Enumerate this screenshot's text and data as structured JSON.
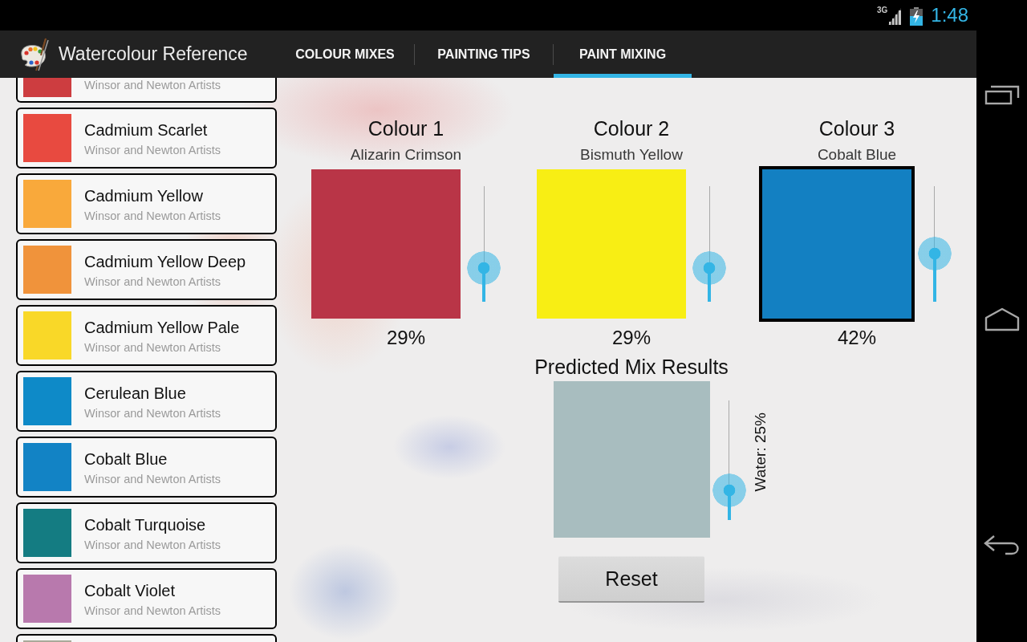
{
  "status_bar": {
    "network": "3G",
    "time": "1:48"
  },
  "app_bar": {
    "title": "Watercolour Reference",
    "tabs": [
      {
        "label": "COLOUR MIXES",
        "selected": false
      },
      {
        "label": "PAINTING TIPS",
        "selected": false
      },
      {
        "label": "PAINT MIXING",
        "selected": true
      }
    ]
  },
  "paint_list": [
    {
      "maker": "Winsor and Newton Artists",
      "color": "#cd3d40"
    },
    {
      "name": "Cadmium Scarlet",
      "maker": "Winsor and Newton Artists",
      "color": "#e84a40"
    },
    {
      "name": "Cadmium Yellow",
      "maker": "Winsor and Newton Artists",
      "color": "#f9a93b"
    },
    {
      "name": "Cadmium Yellow Deep",
      "maker": "Winsor and Newton Artists",
      "color": "#f0933b"
    },
    {
      "name": "Cadmium Yellow Pale",
      "maker": "Winsor and Newton Artists",
      "color": "#f9d828"
    },
    {
      "name": "Cerulean Blue",
      "maker": "Winsor and Newton Artists",
      "color": "#0e8ac8"
    },
    {
      "name": "Cobalt Blue",
      "maker": "Winsor and Newton Artists",
      "color": "#1283c5"
    },
    {
      "name": "Cobalt Turquoise",
      "maker": "Winsor and Newton Artists",
      "color": "#147c82"
    },
    {
      "name": "Cobalt Violet",
      "maker": "Winsor and Newton Artists",
      "color": "#b879ad"
    },
    {
      "color": "#a9a999"
    }
  ],
  "mixer": {
    "colours": [
      {
        "title": "Colour 1",
        "paint": "Alizarin Crimson",
        "color": "#b93547",
        "selected": false,
        "level": 0.29,
        "percent": "29%"
      },
      {
        "title": "Colour 2",
        "paint": "Bismuth Yellow",
        "color": "#f8ee14",
        "selected": false,
        "level": 0.29,
        "percent": "29%"
      },
      {
        "title": "Colour 3",
        "paint": "Cobalt Blue",
        "color": "#1380c2",
        "selected": true,
        "level": 0.42,
        "percent": "42%"
      }
    ],
    "result": {
      "title": "Predicted Mix Results",
      "color": "#a8bdbf",
      "water": {
        "level": 0.25,
        "label": "Water: 25%"
      }
    },
    "reset_button": "Reset"
  }
}
